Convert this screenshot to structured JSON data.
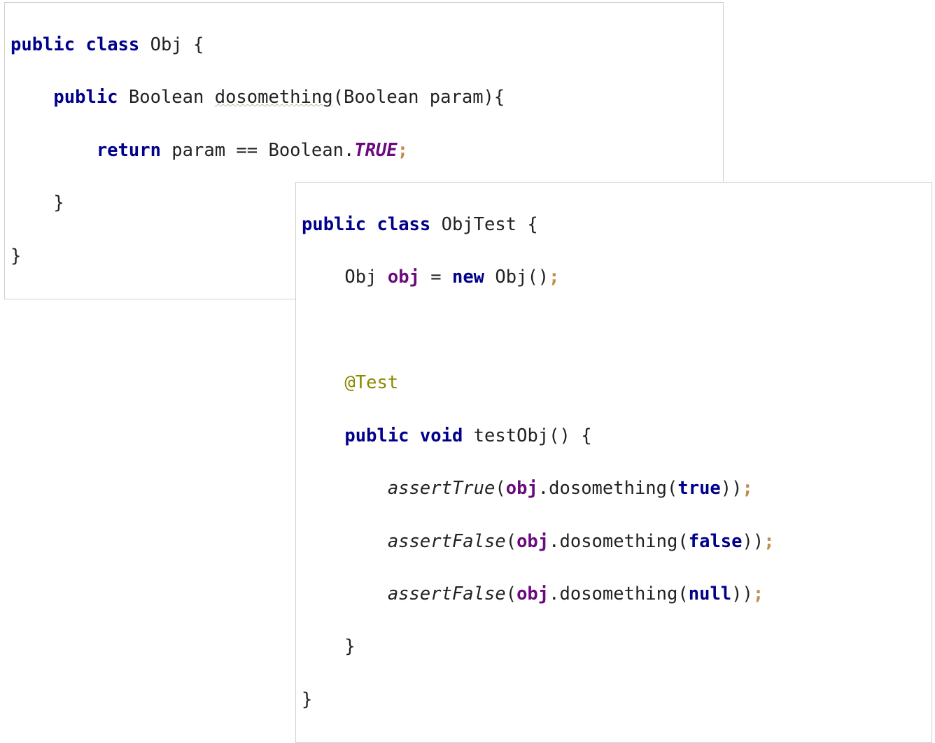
{
  "box1": {
    "l1_public": "public",
    "l1_class": "class",
    "l1_name": " Obj {",
    "l2_indent": "    ",
    "l2_public": "public",
    "l2_rettype": " Boolean ",
    "l2_method": "dosomething",
    "l2_params": "(Boolean param){",
    "l3_indent": "        ",
    "l3_return": "return",
    "l3_expr": " param == Boolean.",
    "l3_true": "TRUE",
    "l3_semi": ";",
    "l4_indent": "    ",
    "l4_brace": "}",
    "l5_brace": "}"
  },
  "box2": {
    "l1_public": "public",
    "l1_class": "class",
    "l1_name": " ObjTest {",
    "l2_indent": "    ",
    "l2_type": "Obj ",
    "l2_var": "obj",
    "l2_eq": " = ",
    "l2_new": "new",
    "l2_ctor": " Obj()",
    "l2_semi": ";",
    "l3_blank": " ",
    "l4_indent": "    ",
    "l4_ann": "@Test",
    "l5_indent": "    ",
    "l5_public": "public",
    "l5_void": "void",
    "l5_sig": " testObj() {",
    "l6_indent": "        ",
    "l6_assert": "assertTrue",
    "l6_open": "(",
    "l6_obj": "obj",
    "l6_call": ".dosomething(",
    "l6_true": "true",
    "l6_close": "))",
    "l6_semi": ";",
    "l7_indent": "        ",
    "l7_assert": "assertFalse",
    "l7_open": "(",
    "l7_obj": "obj",
    "l7_call": ".dosomething(",
    "l7_false": "false",
    "l7_close": "))",
    "l7_semi": ";",
    "l8_indent": "        ",
    "l8_assert": "assertFalse",
    "l8_open": "(",
    "l8_obj": "obj",
    "l8_call": ".dosomething(",
    "l8_null": "null",
    "l8_close": "))",
    "l8_semi": ";",
    "l9_indent": "    ",
    "l9_brace": "}",
    "l10_brace": "}"
  }
}
